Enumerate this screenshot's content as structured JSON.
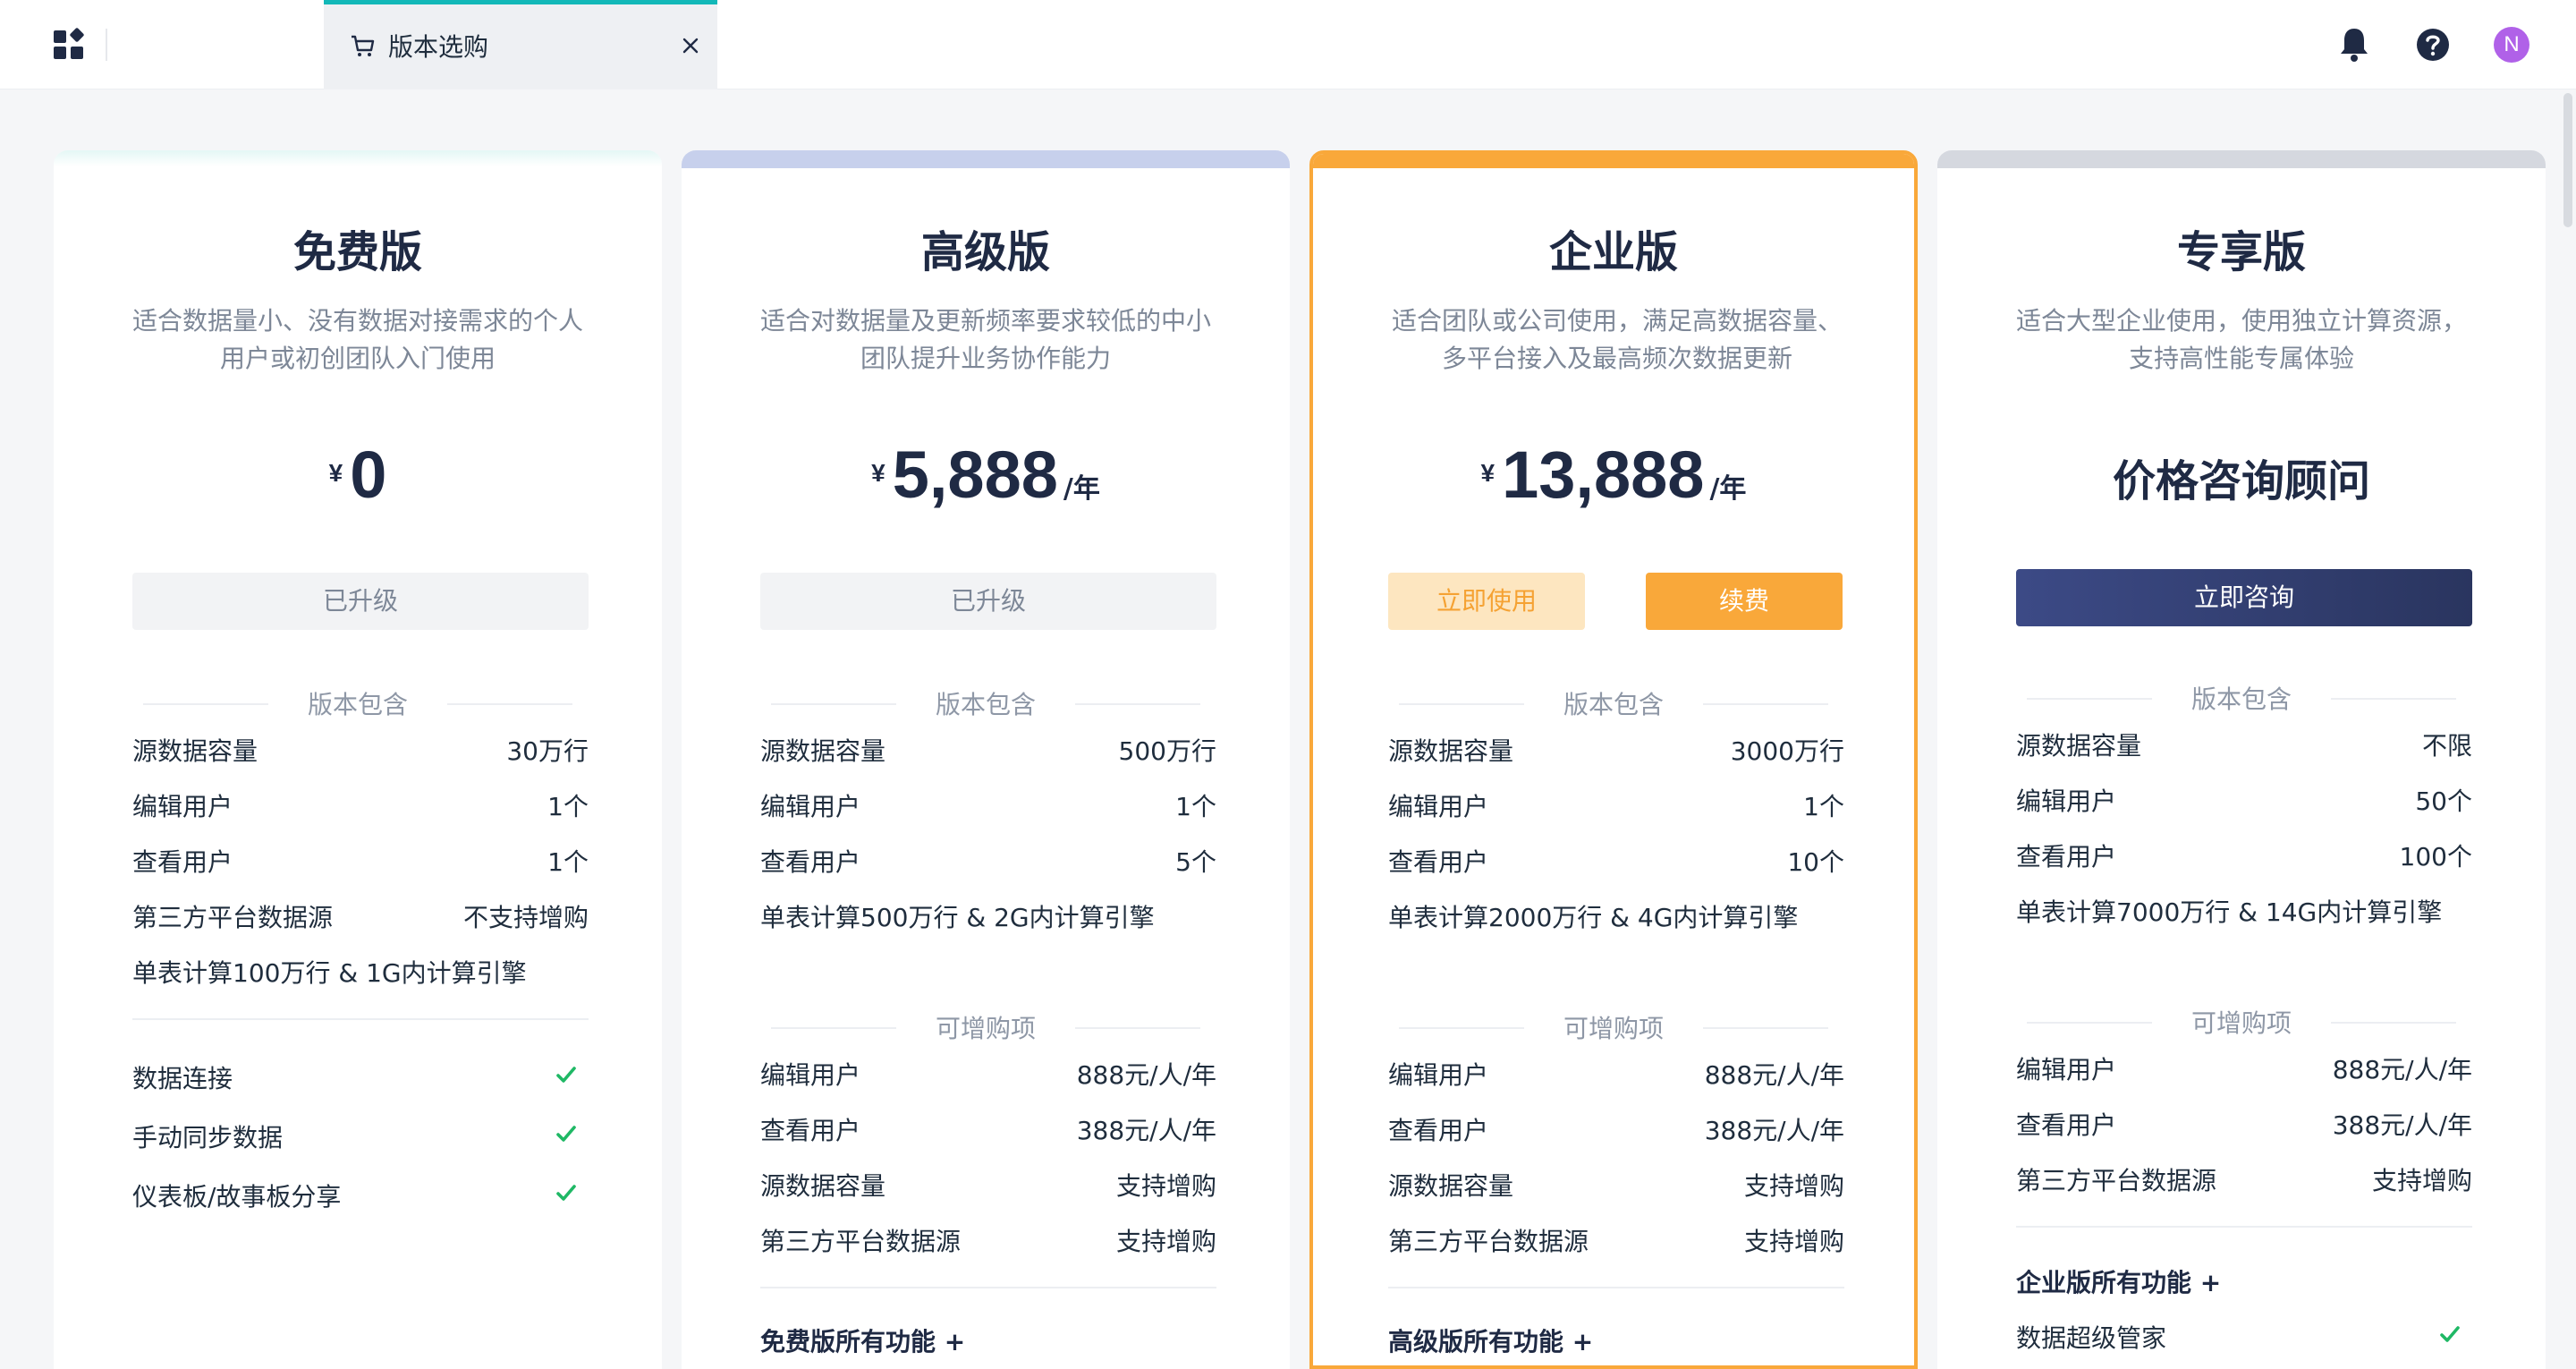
{
  "tab": {
    "label": "版本选购"
  },
  "user": {
    "avatar_letter": "N"
  },
  "colors": {
    "accent_teal": "#12b8b8",
    "enterprise_orange": "#f9a83a",
    "check_green": "#1fb865",
    "navy": "#2e3a6b"
  },
  "section_labels": {
    "includes": "版本包含",
    "addons": "可增购项"
  },
  "plans": [
    {
      "title": "免费版",
      "desc": "适合数据量小、没有数据对接需求的个人用户或初创团队入门使用",
      "currency": "¥",
      "price": "0",
      "button": "已升级",
      "includes": [
        {
          "k": "源数据容量",
          "v": "30万行"
        },
        {
          "k": "编辑用户",
          "v": "1个"
        },
        {
          "k": "查看用户",
          "v": "1个"
        },
        {
          "k": "第三方平台数据源",
          "v": "不支持增购"
        },
        {
          "k": "单表计算100万行 & 1G内计算引擎",
          "v": ""
        }
      ],
      "features": [
        "数据连接",
        "手动同步数据",
        "仪表板/故事板分享"
      ]
    },
    {
      "title": "高级版",
      "desc": "适合对数据量及更新频率要求较低的中小团队提升业务协作能力",
      "currency": "¥",
      "price": "5,888",
      "unit": "/年",
      "button": "已升级",
      "includes": [
        {
          "k": "源数据容量",
          "v": "500万行"
        },
        {
          "k": "编辑用户",
          "v": "1个"
        },
        {
          "k": "查看用户",
          "v": "5个"
        },
        {
          "k": "单表计算500万行 & 2G内计算引擎",
          "v": ""
        }
      ],
      "addons": [
        {
          "k": "编辑用户",
          "v": "888元/人/年"
        },
        {
          "k": "查看用户",
          "v": "388元/人/年"
        },
        {
          "k": "源数据容量",
          "v": "支持增购"
        },
        {
          "k": "第三方平台数据源",
          "v": "支持增购"
        }
      ],
      "all_features": "免费版所有功能 +"
    },
    {
      "title": "企业版",
      "desc": "适合团队或公司使用，满足高数据容量、多平台接入及最高频次数据更新",
      "currency": "¥",
      "price": "13,888",
      "unit": "/年",
      "button_use": "立即使用",
      "button_renew": "续费",
      "includes": [
        {
          "k": "源数据容量",
          "v": "3000万行"
        },
        {
          "k": "编辑用户",
          "v": "1个"
        },
        {
          "k": "查看用户",
          "v": "10个"
        },
        {
          "k": "单表计算2000万行 & 4G内计算引擎",
          "v": ""
        }
      ],
      "addons": [
        {
          "k": "编辑用户",
          "v": "888元/人/年"
        },
        {
          "k": "查看用户",
          "v": "388元/人/年"
        },
        {
          "k": "源数据容量",
          "v": "支持增购"
        },
        {
          "k": "第三方平台数据源",
          "v": "支持增购"
        }
      ],
      "all_features": "高级版所有功能 +"
    },
    {
      "title": "专享版",
      "desc": "适合大型企业使用，使用独立计算资源，支持高性能专属体验",
      "price_text": "价格咨询顾问",
      "button": "立即咨询",
      "includes": [
        {
          "k": "源数据容量",
          "v": "不限"
        },
        {
          "k": "编辑用户",
          "v": "50个"
        },
        {
          "k": "查看用户",
          "v": "100个"
        },
        {
          "k": "单表计算7000万行 & 14G内计算引擎",
          "v": ""
        }
      ],
      "addons": [
        {
          "k": "编辑用户",
          "v": "888元/人/年"
        },
        {
          "k": "查看用户",
          "v": "388元/人/年"
        },
        {
          "k": "第三方平台数据源",
          "v": "支持增购"
        }
      ],
      "all_features": "企业版所有功能 +",
      "extra_features": [
        "数据超级管家"
      ]
    }
  ]
}
